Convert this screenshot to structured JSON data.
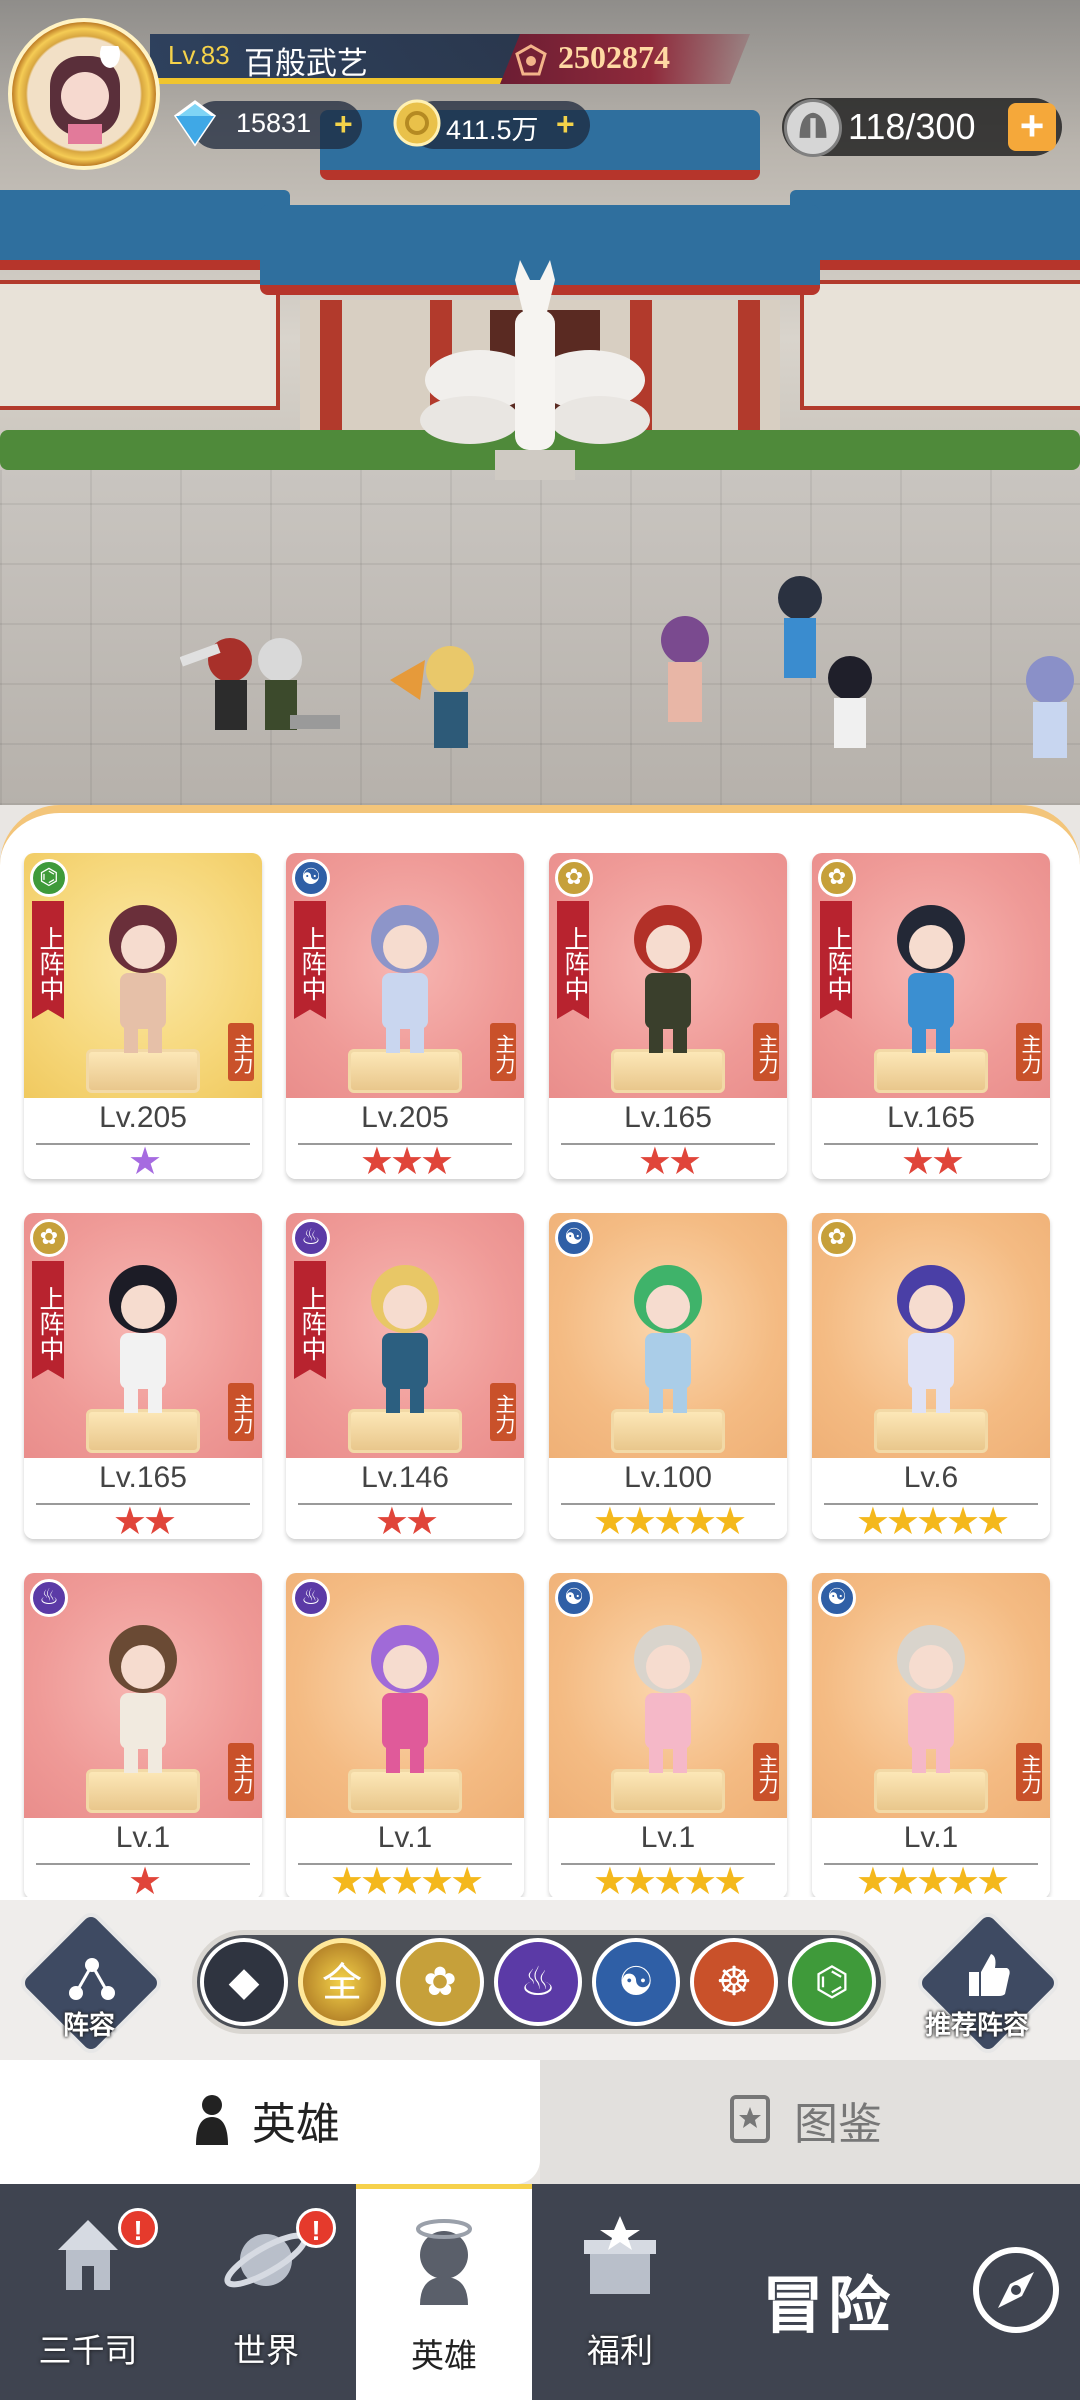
{
  "player": {
    "level": "Lv.83",
    "name": "百般武艺",
    "power": "2502874",
    "diamonds": "15831",
    "gold": "411.5万",
    "stamina": "118/300"
  },
  "icons": {
    "diamond": "diamond-icon",
    "gold": "gold-coin-icon",
    "stamina": "helmet-stamina-icon",
    "power": "power-crest-icon"
  },
  "cards": [
    {
      "faction": "dna",
      "faction_color": "#3f9a3a",
      "deployed": true,
      "level": "Lv.205",
      "stars": "★",
      "star_count": 1,
      "star_color": "purple",
      "bg": "gold",
      "role": "主力"
    },
    {
      "faction": "yin-yang",
      "faction_color": "#2f5fa6",
      "deployed": true,
      "level": "Lv.205",
      "stars": "★★★",
      "star_count": 3,
      "star_color": "red",
      "bg": "red",
      "role": "主力"
    },
    {
      "faction": "lotus",
      "faction_color": "#c6a03a",
      "deployed": true,
      "level": "Lv.165",
      "stars": "★★",
      "star_count": 2,
      "star_color": "red",
      "bg": "red",
      "role": "主力"
    },
    {
      "faction": "lotus",
      "faction_color": "#c6a03a",
      "deployed": true,
      "level": "Lv.165",
      "stars": "★★",
      "star_count": 2,
      "star_color": "red",
      "bg": "red",
      "role": "主力"
    },
    {
      "faction": "lotus",
      "faction_color": "#c6a03a",
      "deployed": true,
      "level": "Lv.165",
      "stars": "★★",
      "star_count": 2,
      "star_color": "red",
      "bg": "red",
      "role": "主力"
    },
    {
      "faction": "flame",
      "faction_color": "#5b3aa6",
      "deployed": true,
      "level": "Lv.146",
      "stars": "★★",
      "star_count": 2,
      "star_color": "red",
      "bg": "red",
      "role": "主力"
    },
    {
      "faction": "yin-yang",
      "faction_color": "#2f5fa6",
      "deployed": false,
      "level": "Lv.100",
      "stars": "★★★★★",
      "star_count": 5,
      "star_color": "yellow",
      "bg": "orange",
      "role": ""
    },
    {
      "faction": "lotus",
      "faction_color": "#c6a03a",
      "deployed": false,
      "level": "Lv.6",
      "stars": "★★★★★",
      "star_count": 5,
      "star_color": "yellow",
      "bg": "orange",
      "role": ""
    },
    {
      "faction": "flame",
      "faction_color": "#5b3aa6",
      "deployed": false,
      "level": "Lv.1",
      "stars": "★",
      "star_count": 1,
      "star_color": "red",
      "bg": "red",
      "role": "主力"
    },
    {
      "faction": "flame",
      "faction_color": "#5b3aa6",
      "deployed": false,
      "level": "Lv.1",
      "stars": "★★★★★",
      "star_count": 5,
      "star_color": "yellow",
      "bg": "orange",
      "role": ""
    },
    {
      "faction": "yin-yang",
      "faction_color": "#2f5fa6",
      "deployed": false,
      "level": "Lv.1",
      "stars": "★★★★★",
      "star_count": 5,
      "star_color": "yellow",
      "bg": "orange",
      "role": "主力"
    },
    {
      "faction": "yin-yang",
      "faction_color": "#2f5fa6",
      "deployed": false,
      "level": "Lv.1",
      "stars": "★★★★★",
      "star_count": 5,
      "star_color": "yellow",
      "bg": "orange",
      "role": "主力"
    }
  ],
  "deploy_label": "上阵中",
  "filters": {
    "lineup_label": "阵容",
    "recommend_label": "推荐阵容",
    "all_label": "全",
    "items": [
      {
        "name": "diamond-filter-icon",
        "color": "#2f3440"
      },
      {
        "name": "all-filter",
        "color": "#c08a2a"
      },
      {
        "name": "lotus-filter-icon",
        "color": "#c6a03a"
      },
      {
        "name": "flame-filter-icon",
        "color": "#5b3aa6"
      },
      {
        "name": "yin-yang-filter-icon",
        "color": "#2f5fa6"
      },
      {
        "name": "meditation-filter-icon",
        "color": "#c9512a"
      },
      {
        "name": "dna-filter-icon",
        "color": "#3f9a3a"
      }
    ]
  },
  "tabs": {
    "hero": "英雄",
    "codex": "图鉴"
  },
  "nav": {
    "items": [
      {
        "label": "三千司",
        "badge": "!"
      },
      {
        "label": "世界",
        "badge": "!"
      },
      {
        "label": "英雄",
        "badge": ""
      },
      {
        "label": "福利",
        "badge": ""
      }
    ],
    "adventure": "冒险"
  }
}
